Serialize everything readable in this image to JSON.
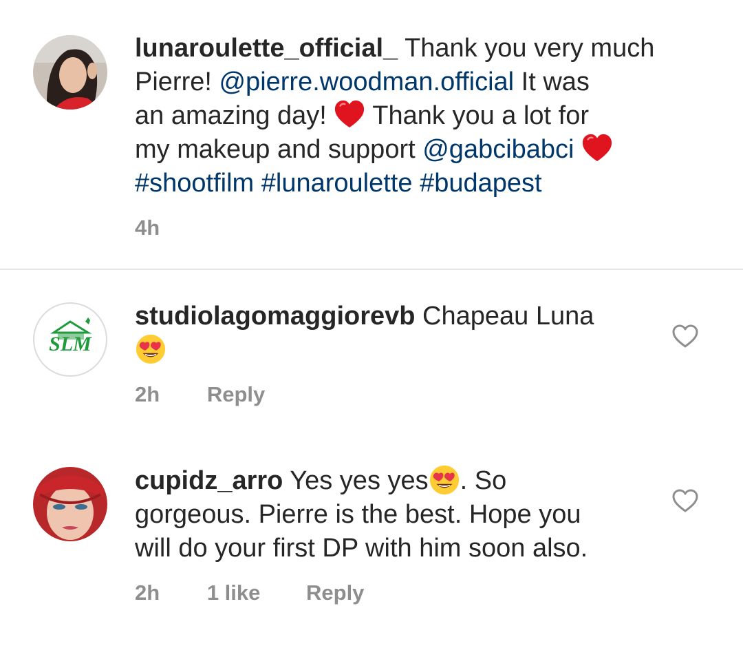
{
  "caption": {
    "username": "lunaroulette_official_",
    "line1_rest": " Thank you very much",
    "line2_pre": "Pierre!  ",
    "mention1": "@pierre.woodman.official",
    "line2_post": " It was",
    "line3_pre": "an amazing day! ",
    "line3_post": " Thank you a lot for",
    "line4_pre": "my makeup and support ",
    "mention2": "@gabcibabci",
    "hashtag1": "#shootfilm",
    "hashtag2": "#lunaroulette",
    "hashtag3": "#budapest",
    "time": "4h"
  },
  "comments": [
    {
      "username": "studiolagomaggiorevb",
      "text": " Chapeau Luna",
      "avatar_text": "SLM",
      "time": "2h",
      "reply_label": "Reply"
    },
    {
      "username": "cupidz_arro",
      "text_pre": " Yes yes yes",
      "text_post": ". So",
      "line2": "gorgeous. Pierre is the best. Hope you",
      "line3": "will do your first DP with him soon also.",
      "time": "2h",
      "likes": "1 like",
      "reply_label": "Reply"
    }
  ],
  "icons": {
    "heart_red": "red-heart-emoji",
    "heart_eyes": "heart-eyes-emoji",
    "like": "heart-outline-icon"
  },
  "colors": {
    "text": "#262626",
    "link": "#00376b",
    "meta": "#8e8e8e",
    "emoji_red": "#e0141e",
    "slm_green": "#1f9a3c"
  }
}
